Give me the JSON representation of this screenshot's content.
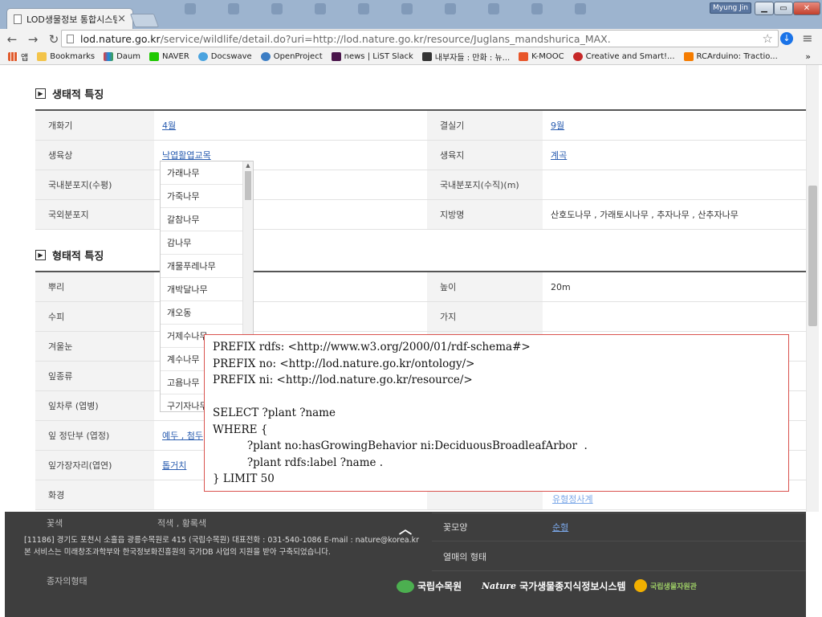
{
  "browser": {
    "tab_title": "LOD생물정보 통합시스템",
    "user_badge": "Myung Jin",
    "url_host": "lod.nature.go.kr",
    "url_path": "/service/wildlife/detail.do?uri=http://lod.nature.go.kr/resource/Juglans_mandshurica_MAX.",
    "bookmarks": [
      "앱",
      "Bookmarks",
      "Daum",
      "NAVER",
      "Docswave",
      "OpenProject",
      "news | LiST Slack",
      "내부자들 : 만화 : 뉴...",
      "K-MOOC",
      "Creative and Smart!...",
      "RCArduino: Tractio..."
    ],
    "bookmark_more": "»"
  },
  "sections": {
    "ecology_title": "생태적 특징",
    "morphology_title": "형태적 특징"
  },
  "ecology": {
    "rows": [
      {
        "l1": "개화기",
        "v1": "4월",
        "l2": "결실기",
        "v2": "9월"
      },
      {
        "l1": "생육상",
        "v1": "낙엽활엽교목",
        "l2": "생육지",
        "v2": "계곡"
      },
      {
        "l1": "국내분포지(수평)",
        "v1": "",
        "l2": "국내분포지(수직)(m)",
        "v2": ""
      },
      {
        "l1": "국외분포지",
        "v1": "",
        "l2": "지방명",
        "v2": "산호도나무 , 가래토시나무 , 추자나무 , 산추자나무"
      }
    ]
  },
  "morphology": {
    "rows": [
      {
        "l1": "뿌리",
        "v1": "",
        "l2": "높이",
        "v2": "20m"
      },
      {
        "l1": "수피",
        "v1": "",
        "l2": "가지",
        "v2": ""
      },
      {
        "l1": "겨울눈",
        "v1": "",
        "l2": "",
        "v2": ""
      },
      {
        "l1": "잎종류",
        "v1": "",
        "l2": "",
        "v2": ""
      },
      {
        "l1": "잎차루 (엽병)",
        "v1": "",
        "l2": "",
        "v2": ""
      },
      {
        "l1": "잎 정단부 (엽정)",
        "v1": "예두 , 첨두",
        "l2": "",
        "v2": ""
      },
      {
        "l1": "잎가장자리(엽연)",
        "v1": "톱거치",
        "l2": "",
        "v2": ""
      },
      {
        "l1": "화경",
        "v1": "",
        "l2": "",
        "v2": ""
      }
    ]
  },
  "dropdown": {
    "items": [
      "가래나무",
      "가죽나무",
      "갈참나무",
      "감나무",
      "개물푸레나무",
      "개박달나무",
      "개오동",
      "거제수나무",
      "계수나무",
      "고욤나무",
      "구기자나무"
    ]
  },
  "sparql": {
    "lines": [
      "PREFIX rdfs: <http://www.w3.org/2000/01/rdf-schema#>",
      "PREFIX no: <http://lod.nature.go.kr/ontology/>",
      "PREFIX ni: <http://lod.nature.go.kr/resource/>",
      "",
      "SELECT ?plant ?name",
      "WHERE {",
      "          ?plant no:hasGrowingBehavior ni:DeciduousBroadleafArbor  .",
      "          ?plant rdfs:label ?name .",
      "} LIMIT 50"
    ]
  },
  "footer": {
    "address_line1": "[11186] 경기도 포천시 소흘읍 광릉수목원로 415 (국립수목원) 대표전화 : 031-540-1086 E-mail : nature@korea.kr",
    "address_line2": "본 서비스는 미래창조과학부와 한국정보화진흥원의 국가DB 사업의 지원을 받아 구축되었습니다.",
    "ghost_rows": [
      {
        "l": "",
        "v": "유형정사계"
      },
      {
        "l": "꽃모양",
        "v": "순형"
      },
      {
        "l": "열매의 형태",
        "v": ""
      }
    ],
    "ghost_left": [
      "꽃색",
      "종자의형태"
    ],
    "ghost_left_value": "적색 , 황록색",
    "logos": [
      "국립수목원",
      "국가생물종지식정보시스템",
      "국립생물자원관"
    ],
    "logo_nature": "Nature"
  },
  "colors": {
    "link": "#2a5db0",
    "sparql_border": "#d9534f",
    "footer_bg": "#1e1e1e"
  }
}
